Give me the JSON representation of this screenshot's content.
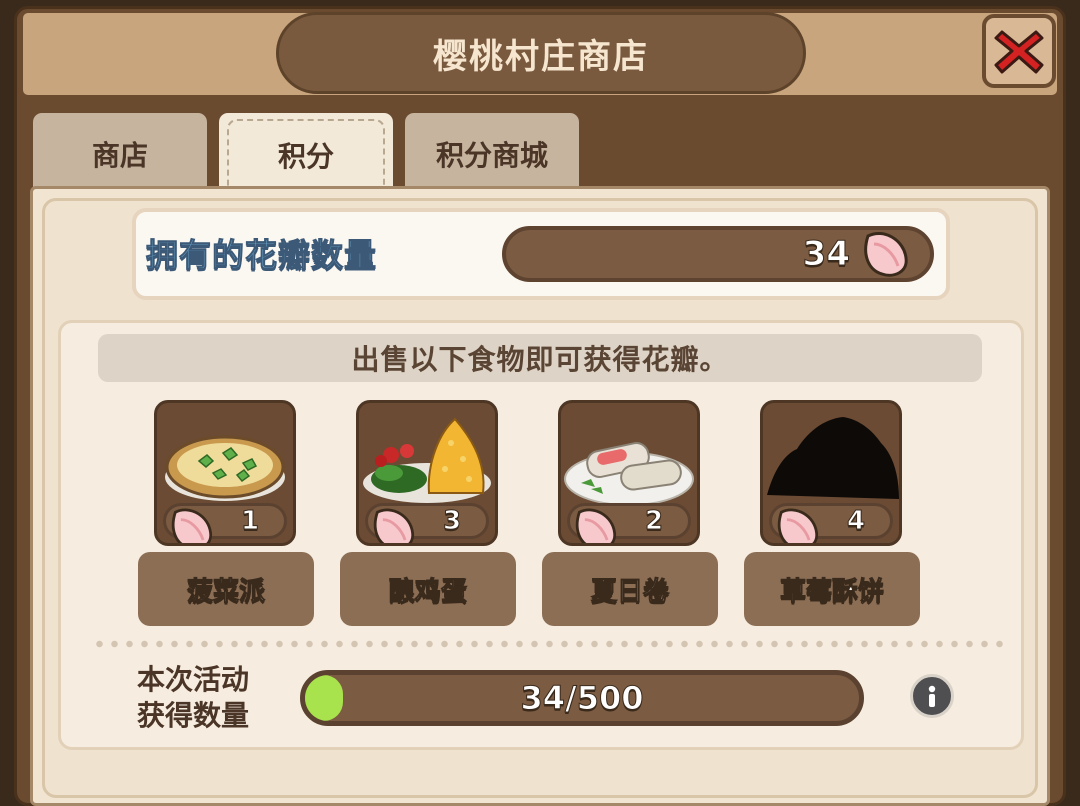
{
  "shop": {
    "title": "樱桃村庄商店",
    "close_icon": "close-x-icon",
    "accent_color": "#d42222"
  },
  "tabs": [
    {
      "label": "商店",
      "active": false
    },
    {
      "label": "积分",
      "active": true
    },
    {
      "label": "积分商城",
      "active": false
    }
  ],
  "petals": {
    "label": "拥有的花瓣数量",
    "count": "34",
    "icon": "petal-icon"
  },
  "instruction": "出售以下食物即可获得花瓣。",
  "foods": [
    {
      "name": "菠菜派",
      "reward": "1",
      "icon": "spinach-pie-icon",
      "locked": false
    },
    {
      "name": "酿鸡蛋",
      "reward": "3",
      "icon": "stuffed-egg-icon",
      "locked": false
    },
    {
      "name": "夏日卷",
      "reward": "2",
      "icon": "summer-roll-icon",
      "locked": false
    },
    {
      "name": "草莓酥饼",
      "reward": "4",
      "icon": "strawberry-shortcake-silhouette-icon",
      "locked": true
    }
  ],
  "event": {
    "label_line1": "本次活动",
    "label_line2": "获得数量",
    "progress_text": "34/500",
    "progress_fraction": 0.068,
    "fill_color": "#a8e24c",
    "info_icon": "info-icon"
  }
}
